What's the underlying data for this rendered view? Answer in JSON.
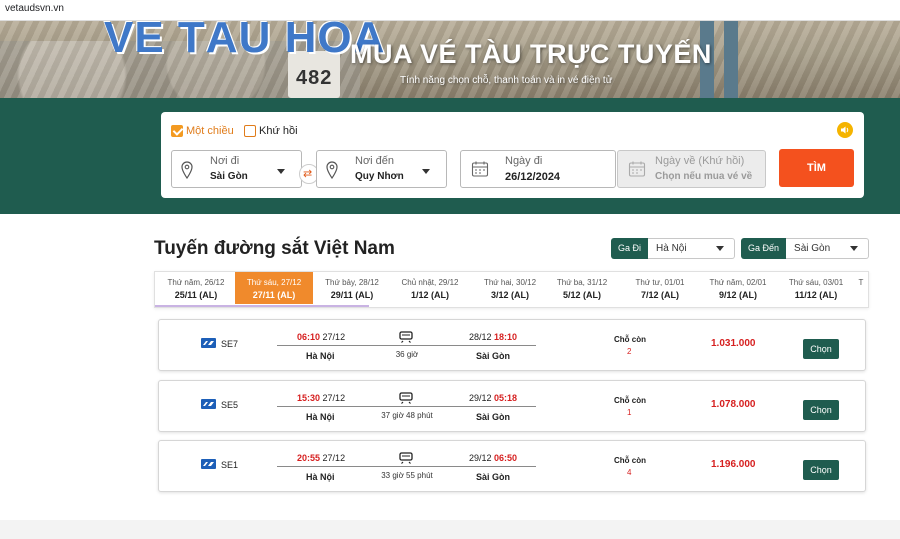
{
  "browser": {
    "url": "vetaudsvn.vn"
  },
  "banner": {
    "logo_text": "VÉ TÀU HỎA",
    "post_number": "482",
    "headline": "MUA VÉ TÀU TRỰC TUYẾN",
    "subline": "Tính năng chọn chỗ, thanh toán và in vé điện tử"
  },
  "search": {
    "one_way_label": "Một chiều",
    "round_trip_label": "Khứ hồi",
    "from_label": "Nơi đi",
    "from_value": "Sài Gòn",
    "to_label": "Nơi đến",
    "to_value": "Quy Nhơn",
    "date_label": "Ngày đi",
    "date_value": "26/12/2024",
    "return_label": "Ngày về (Khứ hồi)",
    "return_value": "Chọn nếu mua vé về",
    "search_button": "TÌM",
    "swap_icon": "⇄",
    "accent_color": "#f4511e"
  },
  "route": {
    "title": "Tuyến đường sắt Việt Nam",
    "ga_di_label": "Ga Đi",
    "ga_di_value": "Hà Nội",
    "ga_den_label": "Ga Đến",
    "ga_den_value": "Sài Gòn"
  },
  "date_tabs": [
    {
      "day": "Thứ năm, 26/12",
      "lunar": "25/11 (AL)"
    },
    {
      "day": "Thứ sáu, 27/12",
      "lunar": "27/11 (AL)"
    },
    {
      "day": "Thứ bảy, 28/12",
      "lunar": "29/11 (AL)"
    },
    {
      "day": "Chủ nhật, 29/12",
      "lunar": "1/12 (AL)"
    },
    {
      "day": "Thứ hai, 30/12",
      "lunar": "3/12 (AL)"
    },
    {
      "day": "Thứ ba, 31/12",
      "lunar": "5/12 (AL)"
    },
    {
      "day": "Thứ tư, 01/01",
      "lunar": "7/12 (AL)"
    },
    {
      "day": "Thứ năm, 02/01",
      "lunar": "9/12 (AL)"
    },
    {
      "day": "Thứ sáu, 03/01",
      "lunar": "11/12 (AL)"
    },
    {
      "day": "T",
      "lunar": ""
    }
  ],
  "trains": [
    {
      "code": "SE7",
      "dep_time": "06:10",
      "dep_date": "27/12",
      "arr_date": "28/12",
      "arr_time": "18:10",
      "duration": "36 giờ",
      "from": "Hà Nội",
      "to": "Sài Gòn",
      "seat_label": "Chỗ còn",
      "seats": "2",
      "price": "1.031.000",
      "button": "Chọn"
    },
    {
      "code": "SE5",
      "dep_time": "15:30",
      "dep_date": "27/12",
      "arr_date": "29/12",
      "arr_time": "05:18",
      "duration": "37 giờ 48 phút",
      "from": "Hà Nội",
      "to": "Sài Gòn",
      "seat_label": "Chỗ còn",
      "seats": "1",
      "price": "1.078.000",
      "button": "Chọn"
    },
    {
      "code": "SE1",
      "dep_time": "20:55",
      "dep_date": "27/12",
      "arr_date": "29/12",
      "arr_time": "06:50",
      "duration": "33 giờ 55 phút",
      "from": "Hà Nội",
      "to": "Sài Gòn",
      "seat_label": "Chỗ còn",
      "seats": "4",
      "price": "1.196.000",
      "button": "Chọn"
    }
  ]
}
